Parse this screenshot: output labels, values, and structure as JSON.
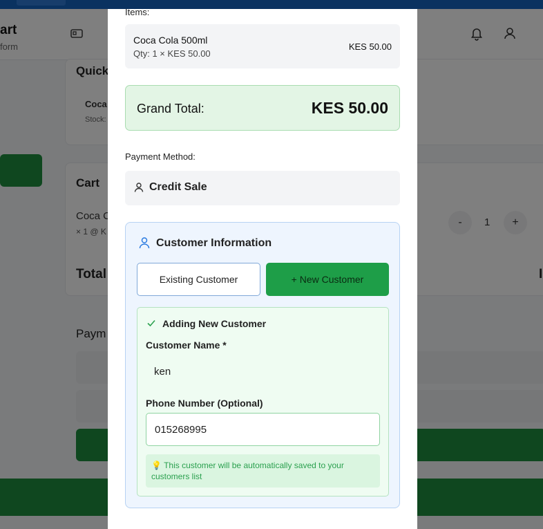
{
  "background": {
    "app_title": "art",
    "app_subtitle": "form",
    "quick_heading": "Quick",
    "quick_item_name": "Coca",
    "quick_item_stock": "Stock:",
    "cart_heading": "Cart",
    "cart_item_name": "Coca C",
    "cart_item_detail": "× 1 @ K",
    "cart_qty_minus": "-",
    "cart_qty_value": "1",
    "cart_qty_plus": "+",
    "total_label": "Total",
    "total_partial": "I",
    "payment_heading": "Paym"
  },
  "modal": {
    "items_label": "Items:",
    "item": {
      "name": "Coca Cola 500ml",
      "qty_line": "Qty: 1 × KES 50.00",
      "price": "KES 50.00"
    },
    "grand_total_label": "Grand Total:",
    "grand_total_value": "KES 50.00",
    "payment_method_label": "Payment Method:",
    "payment_method_value": "Credit Sale",
    "customer_section_title": "Customer Information",
    "existing_customer_button": "Existing Customer",
    "new_customer_button": "+ New Customer",
    "adding_title": "Adding New Customer",
    "customer_name_label": "Customer Name *",
    "customer_name_value": "ken",
    "phone_label": "Phone Number (Optional)",
    "phone_value": "015268995",
    "hint_icon": "💡",
    "hint_text": "This customer will be automatically saved to your customers list"
  },
  "colors": {
    "accent_green": "#1e9e48",
    "brand_blue": "#1565c0",
    "hint_text_green": "#2aa04e"
  }
}
